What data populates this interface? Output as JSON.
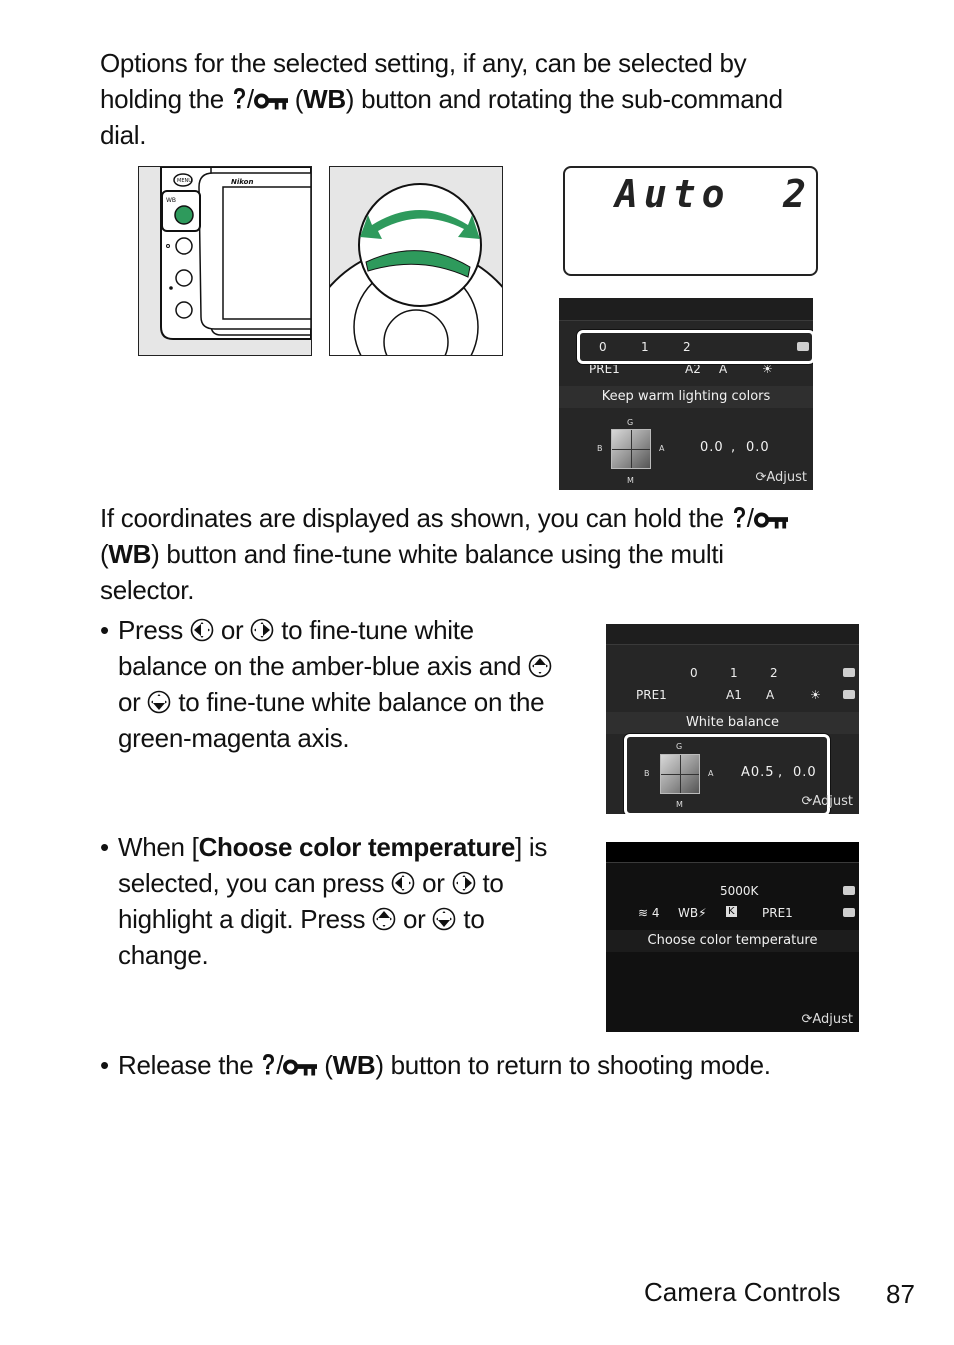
{
  "intro": {
    "line1": "Options for the selected setting, if any, can be selected by",
    "line2_pre": "holding the ",
    "line2_wb": "WB",
    "line2_post": ") button and rotating the sub-command",
    "line3": "dial.",
    "button_icons": [
      "help-icon",
      "protect-key-icon"
    ]
  },
  "figures": {
    "camera_back": {
      "brand": "Nikon",
      "buttons": [
        "MENU",
        "WB",
        "zoom-in",
        "zoom-out",
        "info"
      ],
      "wb_label": "WB",
      "highlight_color": "#2e9a5c"
    },
    "sub_command_dial": {
      "arrow_color": "#2e9a5c"
    },
    "control_panel": {
      "left_text": "Auto",
      "right_text": "2"
    },
    "screen1": {
      "scale": [
        "0",
        "1",
        "2"
      ],
      "options": [
        "PRE1",
        "A2",
        "A",
        "sun"
      ],
      "option_title": "Keep warm lighting colors",
      "axis_labels": {
        "top": "G",
        "bottom": "M",
        "left": "B",
        "right": "A"
      },
      "coord_a": "0.0",
      "coord_sep": ",",
      "coord_b": "0.0",
      "adjust": "Adjust"
    }
  },
  "para2": {
    "line1_pre": "If coordinates are displayed as shown, you can hold the ",
    "line2_wb": "WB",
    "line2_post": ") button and fine-tune white balance using the multi",
    "line3": "selector."
  },
  "bullet1": {
    "line1_pre": "Press ",
    "line1_or": " or ",
    "line1_post": " to fine-tune white",
    "line2_pre": "balance on the amber-blue axis and ",
    "line3_or": "or ",
    "line3_post": " to fine-tune white balance on the",
    "line4": "green-magenta axis."
  },
  "screen2": {
    "scale": [
      "0",
      "1",
      "2"
    ],
    "options": [
      "PRE1",
      "A1",
      "A",
      "sun"
    ],
    "title": "White balance",
    "axis_labels": {
      "top": "G",
      "bottom": "M",
      "left": "B",
      "right": "A"
    },
    "coord_a": "A0.5",
    "coord_sep": ",",
    "coord_b": "0.0",
    "adjust": "Adjust"
  },
  "bullet2": {
    "line1_pre": "When [",
    "line1_bold": "Choose color temperature",
    "line1_post": "] is",
    "line2_pre": "selected, you can press ",
    "line2_or": " or ",
    "line2_post": " to",
    "line3_pre": "highlight a digit. Press ",
    "line3_or": " or ",
    "line3_post": " to",
    "line4": "change."
  },
  "screen3": {
    "value": "5000K",
    "options": [
      "4",
      "WB flash",
      "K",
      "PRE1"
    ],
    "title": "Choose color temperature",
    "adjust": "Adjust"
  },
  "bullet3": {
    "pre": "Release the ",
    "wb": "WB",
    "post": ") button to return to shooting mode."
  },
  "footer": {
    "section": "Camera Controls",
    "page": "87"
  }
}
